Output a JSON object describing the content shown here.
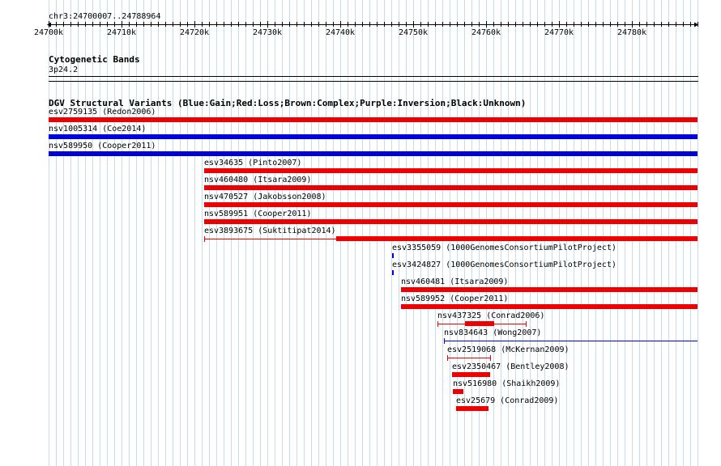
{
  "browser": {
    "position": "chr3:24700007..24788964",
    "view_start": 24700007,
    "view_end": 24788964,
    "ruler_ticks": [
      "24700k",
      "24710k",
      "24720k",
      "24730k",
      "24740k",
      "24750k",
      "24760k",
      "24770k",
      "24780k"
    ]
  },
  "cyto": {
    "title": "Cytogenetic Bands",
    "band": "3p24.2"
  },
  "dgv": {
    "title": "DGV Structural Variants (Blue:Gain;Red:Loss;Brown:Complex;Purple:Inversion;Black:Unknown)",
    "colors": {
      "gain": "#0000dd",
      "loss": "#ee0000"
    },
    "features": [
      {
        "label": "esv2759135 (Redon2006)",
        "type": "loss",
        "start": 24700000,
        "end": 24789000,
        "thick": true
      },
      {
        "label": "nsv1005314 (Coe2014)",
        "type": "gain",
        "start": 24700000,
        "end": 24789000,
        "thick": true
      },
      {
        "label": "nsv589950 (Cooper2011)",
        "type": "gain",
        "start": 24700000,
        "end": 24789000,
        "thick": true
      },
      {
        "label": "esv34635 (Pinto2007)",
        "type": "loss",
        "start": 24721300,
        "end": 24789000,
        "thick": true
      },
      {
        "label": "nsv460480 (Itsara2009)",
        "type": "loss",
        "start": 24721300,
        "end": 24789000,
        "thick": true
      },
      {
        "label": "nsv470527 (Jakobsson2008)",
        "type": "loss",
        "start": 24721300,
        "end": 24789000,
        "thick": true
      },
      {
        "label": "nsv589951 (Cooper2011)",
        "type": "loss",
        "start": 24721300,
        "end": 24789000,
        "thick": true
      },
      {
        "label": "esv3893675 (Suktitipat2014)",
        "type": "loss",
        "start": 24721300,
        "end": 24789000,
        "thick": true,
        "thick_start": 24739400
      },
      {
        "label": "esv3355059 (1000GenomesConsortiumPilotProject)",
        "type": "gain",
        "start": 24747100,
        "end": 24747300,
        "thick": true
      },
      {
        "label": "esv3424827 (1000GenomesConsortiumPilotProject)",
        "type": "gain",
        "start": 24747100,
        "end": 24747300,
        "thick": true
      },
      {
        "label": "nsv460481 (Itsara2009)",
        "type": "loss",
        "start": 24748300,
        "end": 24789000,
        "thick": true
      },
      {
        "label": "nsv589952 (Cooper2011)",
        "type": "loss",
        "start": 24748300,
        "end": 24789000,
        "thick": true
      },
      {
        "label": "nsv437325 (Conrad2006)",
        "type": "loss",
        "start": 24753300,
        "end": 24765600,
        "thick": true,
        "thick_start": 24757100,
        "thick_end": 24761100
      },
      {
        "label": "nsv834643 (Wong2007)",
        "type": "gain",
        "start": 24754200,
        "end": 24789000,
        "thick": false
      },
      {
        "label": "esv2519068 (McKernan2009)",
        "type": "loss",
        "start": 24754700,
        "end": 24760700,
        "thick": false
      },
      {
        "label": "esv2350467 (Bentley2008)",
        "type": "loss",
        "start": 24755300,
        "end": 24760600,
        "thick": true
      },
      {
        "label": "nsv516980 (Shaikh2009)",
        "type": "loss",
        "start": 24755400,
        "end": 24756900,
        "thick": true
      },
      {
        "label": "esv25679 (Conrad2009)",
        "type": "loss",
        "start": 24755900,
        "end": 24760300,
        "thick": true
      }
    ]
  }
}
